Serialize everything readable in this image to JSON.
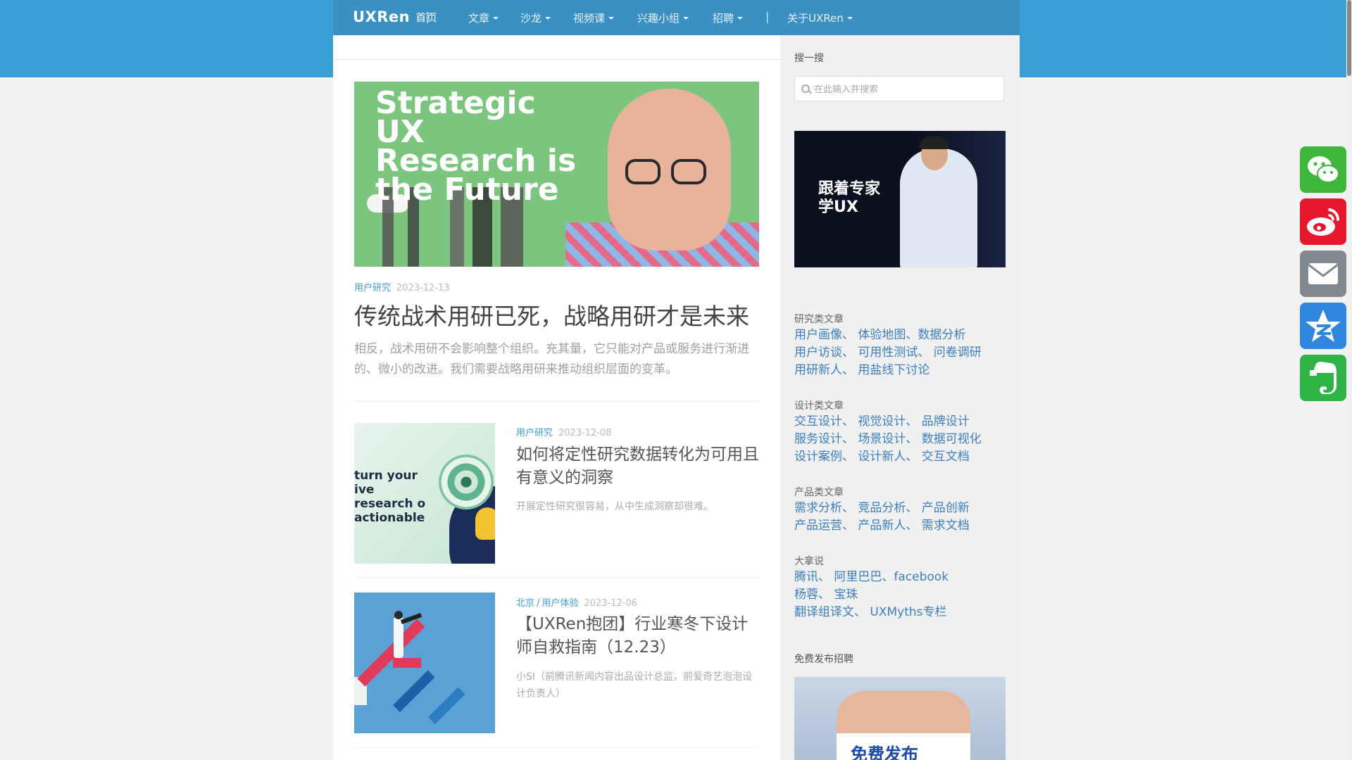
{
  "nav": {
    "logo": "UXRen",
    "home": "首页",
    "sep": "|",
    "items": [
      "文章",
      "沙龙",
      "视频课",
      "兴趣小组",
      "招聘"
    ],
    "about": "关于UXRen"
  },
  "hero": {
    "image_text": "Strategic UX Research is the Future",
    "category": "用户研究",
    "date": "2023-12-13",
    "title": "传统战术用研已死，战略用研才是未来",
    "excerpt": "相反，战术用研不会影响整个组织。充其量，它只能对产品或服务进行渐进的、微小的改进。我们需要战略用研来推动组织层面的变革。"
  },
  "posts": [
    {
      "image_text": "turn your ive research o actionable",
      "categories": [
        "用户研究"
      ],
      "date": "2023-12-08",
      "title": "如何将定性研究数据转化为可用且有意义的洞察",
      "excerpt": "开展定性研究很容易，从中生成洞察却很难。"
    },
    {
      "categories": [
        "北京",
        "用户体验"
      ],
      "date": "2023-12-06",
      "title": "【UXRen抱团】行业寒冬下设计师自救指南（12.23）",
      "excerpt": "小SI（前腾讯新闻内容出品设计总监，前爱奇艺泡泡设计负责人）"
    }
  ],
  "sidebar": {
    "search_title": "搜一搜",
    "search_placeholder": "在此输入并搜索",
    "ad_text": "跟着专家学UX",
    "groups": [
      {
        "label": "研究类文章",
        "lines": [
          "用户画像、 体验地图、数据分析",
          "用户访谈、 可用性测试、 问卷调研",
          "用研新人、 用盐线下讨论"
        ]
      },
      {
        "label": "设计类文章",
        "lines": [
          "交互设计、 视觉设计、 品牌设计",
          "服务设计、 场景设计、 数据可视化",
          "设计案例、 设计新人、 交互文档"
        ]
      },
      {
        "label": "产品类文章",
        "lines": [
          "需求分析、 竞品分析、 产品创新",
          "产品运营、 产品新人、 需求文档"
        ]
      },
      {
        "label": "大拿说",
        "lines": [
          "腾讯、 阿里巴巴、facebook",
          "杨蓉、 宝珠",
          "翻译组译文、 UXMyths专栏"
        ]
      }
    ],
    "recruit_title": "免费发布招聘",
    "recruit_ad_text": "免费发布"
  },
  "share": [
    {
      "icon": "wechat-icon",
      "color": "#3db63b"
    },
    {
      "icon": "weibo-icon",
      "color": "#e6162d"
    },
    {
      "icon": "email-icon",
      "color": "#808890"
    },
    {
      "icon": "qzone-icon",
      "color": "#2f86dd"
    },
    {
      "icon": "evernote-icon",
      "color": "#2fb344"
    }
  ]
}
